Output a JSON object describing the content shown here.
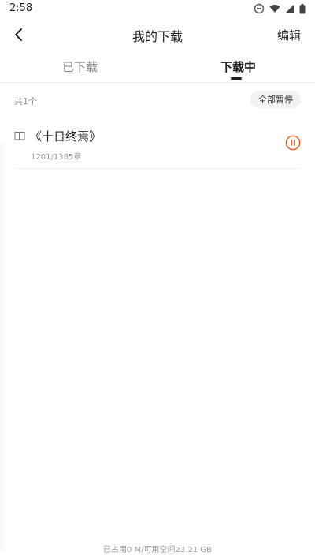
{
  "status_bar": {
    "time": "2:58",
    "icons": [
      "do-not-disturb-icon",
      "wifi-icon",
      "signal-icon",
      "battery-icon"
    ]
  },
  "header": {
    "title": "我的下载",
    "edit_label": "编辑",
    "back_icon": "chevron-left-icon"
  },
  "tabs": [
    {
      "label": "已下载",
      "active": false
    },
    {
      "label": "下载中",
      "active": true
    }
  ],
  "list": {
    "count_text": "共1个",
    "pause_all_label": "全部暂停",
    "items": [
      {
        "title": "《十日终焉》",
        "progress": "1201/1385章",
        "icon": "book-open-icon",
        "action_icon": "pause-icon"
      }
    ]
  },
  "footer": {
    "storage_text": "已占用0 M/可用空间23.21 GB"
  },
  "colors": {
    "accent": "#e8622a",
    "text_primary": "#222222",
    "text_secondary": "#8b8b8b",
    "chip_bg": "#f2f2f2"
  }
}
